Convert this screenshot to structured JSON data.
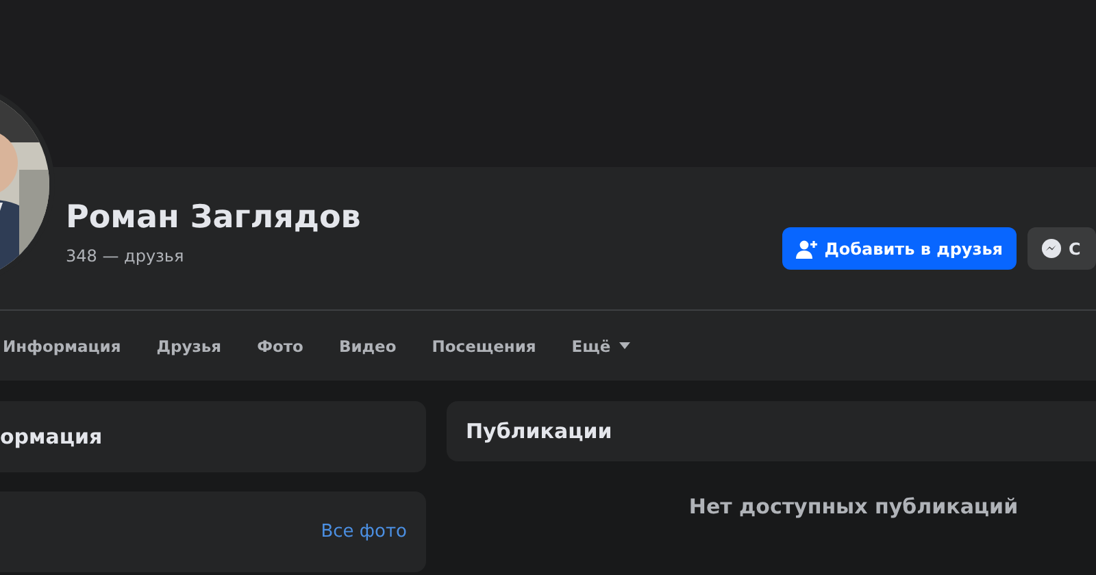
{
  "profile": {
    "name": "Роман Заглядов",
    "friends": "348 — друзья"
  },
  "actions": [
    {
      "kind": "primary",
      "label": "Добавить в друзья"
    },
    {
      "kind": "secondary",
      "label": "С"
    }
  ],
  "tabs": [
    {
      "label": "Информация",
      "dropdown": false
    },
    {
      "label": "Друзья",
      "dropdown": false
    },
    {
      "label": "Фото",
      "dropdown": false
    },
    {
      "label": "Видео",
      "dropdown": false
    },
    {
      "label": "Посещения",
      "dropdown": false
    },
    {
      "label": "Ещё",
      "dropdown": true
    }
  ],
  "info_card": {
    "title": "ормация"
  },
  "photos_card": {
    "link": "Все фото"
  },
  "posts": {
    "title": "Публикации",
    "empty_message": "Нет доступных публикаций"
  }
}
